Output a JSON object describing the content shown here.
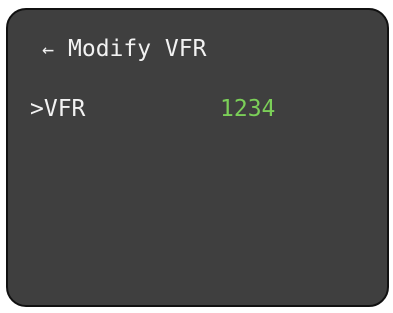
{
  "header": {
    "back_icon": "←",
    "title": "Modify VFR"
  },
  "menu": {
    "selection_cursor": ">",
    "items": [
      {
        "label": "VFR",
        "value": "1234"
      }
    ]
  },
  "colors": {
    "screen_background": "#3f3f3f",
    "text": "#f2f2f2",
    "value_highlight": "#7bcf58"
  }
}
